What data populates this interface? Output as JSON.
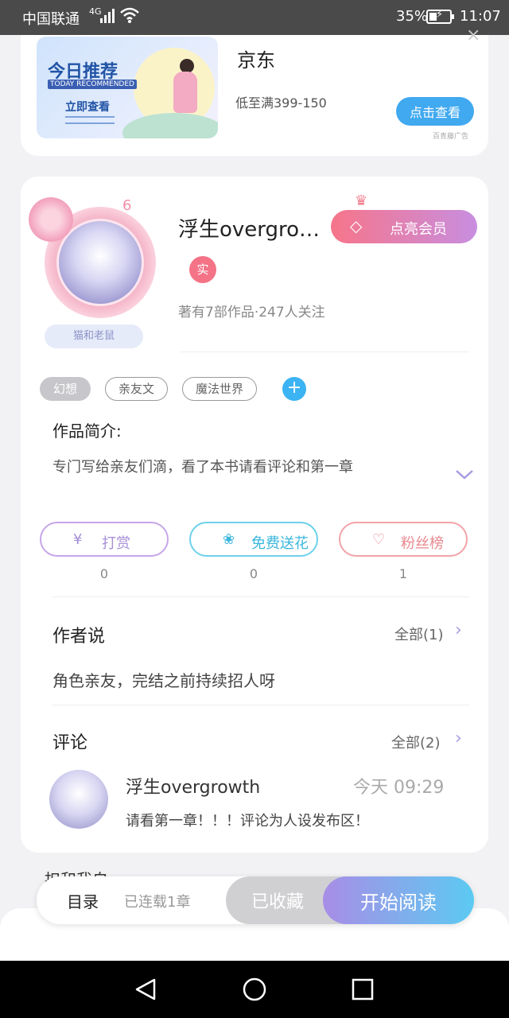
{
  "status_bar": {
    "carrier": "中国联通",
    "network": "4G",
    "battery": "35%",
    "time": "11:07"
  },
  "ad": {
    "banner_title": "今日推荐",
    "banner_subtitle": "TODAY RECOMMENDED",
    "banner_button": "立即查看",
    "title": "京东",
    "description": "低至满399-150",
    "button": "点击查看",
    "source": "百青藤广告",
    "close": "×"
  },
  "author": {
    "avatar_label": "猫和老鼠",
    "level": "6",
    "name": "浮生overgro…",
    "vip_button": "点亮会员",
    "real_badge": "实",
    "stats": "著有7部作品·247人关注"
  },
  "tags": [
    "幻想",
    "亲友文",
    "魔法世界"
  ],
  "tag_add": "+",
  "intro": {
    "heading": "作品简介:",
    "text": "专门写给亲友们滴，看了本书请看评论和第一章"
  },
  "actions": [
    {
      "label": "打赏",
      "icon": "¥",
      "count": "0"
    },
    {
      "label": "免费送花",
      "icon": "❀",
      "count": "0"
    },
    {
      "label": "粉丝榜",
      "icon": "♡",
      "count": "1"
    }
  ],
  "author_says": {
    "title": "作者说",
    "link": "全部(1)",
    "text": "角色亲友，完结之前持续招人呀"
  },
  "comments": {
    "title": "评论",
    "link": "全部(2)",
    "items": [
      {
        "user": "浮生overgrowth",
        "time": "今天 09:29",
        "text": "请看第一章！！！评论为人设发布区！"
      }
    ]
  },
  "below_partial": "扣和我自",
  "bottom_bar": {
    "toc": "目录",
    "status": "已连载1章",
    "collected": "已收藏",
    "read": "开始阅读"
  },
  "colors": {
    "accent_blue": "#40a9f0",
    "vip_gradient_start": "#f6758a",
    "vip_gradient_end": "#c88ee0",
    "read_gradient_start": "#a88de6",
    "read_gradient_end": "#5ccaf2"
  }
}
